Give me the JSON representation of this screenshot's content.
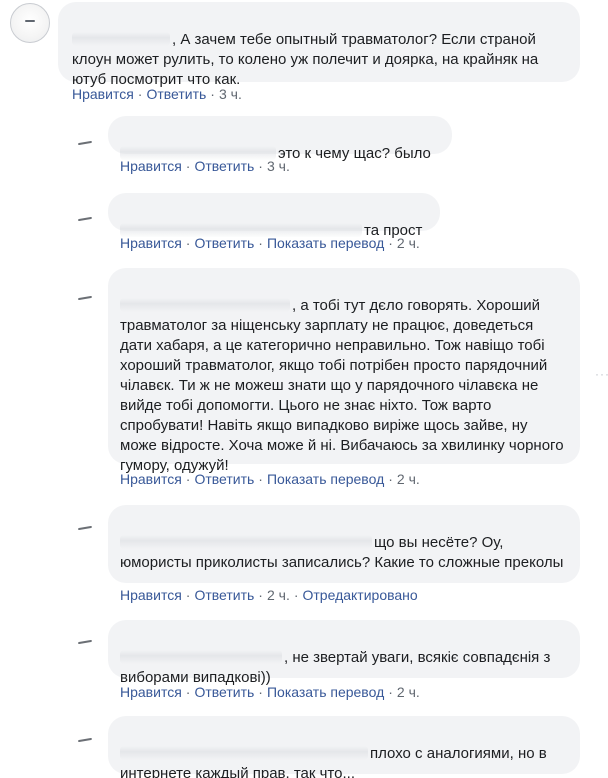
{
  "labels": {
    "like": "Нравится",
    "reply": "Ответить",
    "translate": "Показать перевод",
    "edited": "Отредактировано"
  },
  "comments": [
    {
      "text": ", А зачем тебе опытный травматолог? Если страной клоун может рулить, то колено уж полечит и доярка, на крайняк на ютуб посмотрит что как.",
      "time": "3 ч."
    },
    {
      "text": "это к чему щас? было",
      "time": "3 ч."
    },
    {
      "text": "та прост",
      "time": "2 ч."
    },
    {
      "text": ", а тобі тут дєло говорять. Хороший травматолог за ніщенську зарплату не працює, доведеться дати хабаря, а це категорично неправильно. Тож навіщо тобі хороший травматолог, якщо тобі потрібен просто парядочний чілавєк. Ти ж не можеш знати що у парядочного чілавєка не вийде тобі допомогти. Цього не знає ніхто. Тож варто спробувати! Навіть якщо випадково виріже щось зайве, ну може відросте. Хоча може й ні. Вибачаюсь за хвилинку чорного гумору, одужуй!",
      "time": "2 ч."
    },
    {
      "text": "що вы несёте? Оу, юмористы приколисты записались? Какие то сложные преколы",
      "time": "2 ч."
    },
    {
      "text": ", не звертай уваги, всякіє совпадєнія з виборами випадкові))",
      "time": "2 ч."
    },
    {
      "text": "плохо с аналогиями, но в интернете каждый прав, так что...",
      "time": ""
    }
  ]
}
